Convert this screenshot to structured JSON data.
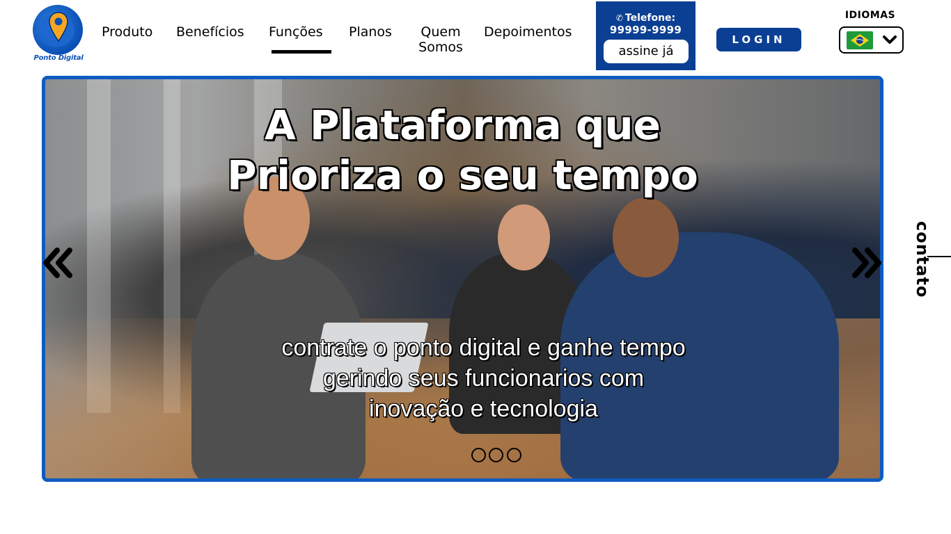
{
  "brand": {
    "name": "Ponto Digital"
  },
  "nav": {
    "items": [
      {
        "label": "Produto"
      },
      {
        "label": "Benefícios"
      },
      {
        "label": "Funções",
        "active": true
      },
      {
        "label": "Planos"
      },
      {
        "label": "Quem Somos"
      },
      {
        "label": "Depoimentos"
      }
    ]
  },
  "contact_box": {
    "phone_label": "Telefone:",
    "phone_number": "99999-9999",
    "subscribe_label": "assine já"
  },
  "login": {
    "label": "LOGIN"
  },
  "language": {
    "title": "IDIOMAS",
    "selected": "Português (Brasil)",
    "icon": "brazil-flag-icon"
  },
  "hero": {
    "title_line1": "A Plataforma que",
    "title_line2": "Prioriza o seu tempo",
    "subtitle_line1": "contrate o ponto digital e ganhe tempo",
    "subtitle_line2": "gerindo seus funcionarios com",
    "subtitle_line3": "inovação e tecnologia",
    "slide_count": 3,
    "prev_icon": "double-chevron-left-icon",
    "next_icon": "double-chevron-right-icon"
  },
  "side_tab": {
    "label": "contato"
  },
  "colors": {
    "primary": "#0b3f93",
    "accent_border": "#0d5cc0",
    "pin": "#f5a623"
  }
}
